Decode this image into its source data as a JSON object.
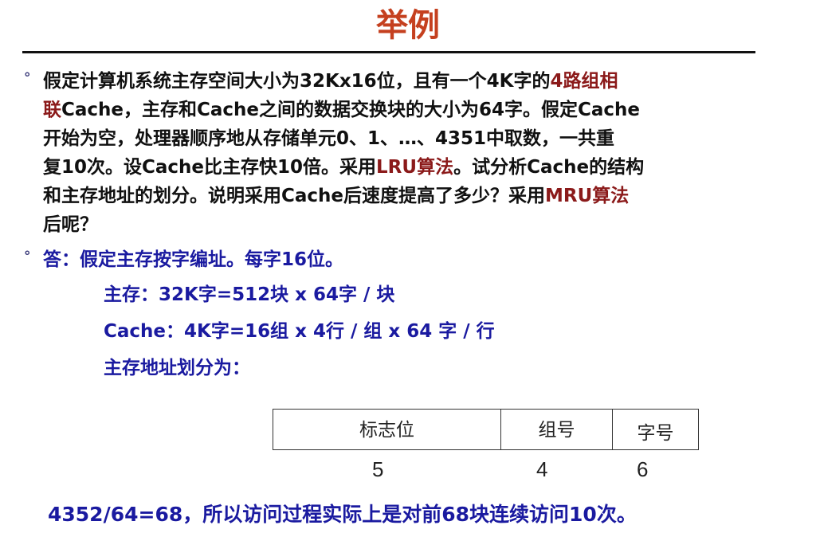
{
  "title": "举例",
  "question": {
    "line1_a": "假定计算机系统主存空间大小为32Kx16位，且有一个4K字的",
    "line1_b": "4路组相",
    "line2_a": "联",
    "line2_b": "Cache，主存和Cache之间的数据交换块的大小为64字。假定Cache",
    "line3": "开始为空，处理器顺序地从存储单元0、1、…、4351中取数，一共重",
    "line4_a": "复10次。设Cache比主存快10倍。采用",
    "line4_b": "LRU算法",
    "line4_c": "。试分析Cache的结构",
    "line5_a": "和主存地址的划分。说明采用Cache后速度提高了多少？采用",
    "line5_b": "MRU算法",
    "line6": "后呢？"
  },
  "answer": {
    "head": "答：假定主存按字编址。每字16位。",
    "main_memory": "主存：32K字=512块 x 64字 / 块",
    "cache": "Cache：4K字=16组 x 4行 / 组 x 64 字 / 行",
    "address_intro": "主存地址划分为："
  },
  "address_fields": {
    "tag_label": "标志位",
    "set_label": "组号",
    "word_label": "字号",
    "tag_bits": "5",
    "set_bits": "4",
    "word_bits": "6"
  },
  "conclusion": "4352/64=68，所以访问过程实际上是对前68块连续访问10次。",
  "bullet_symbol": "°",
  "colors": {
    "title": "#c5401f",
    "highlight": "#8b1a1a",
    "answer": "#1a1aa0"
  }
}
